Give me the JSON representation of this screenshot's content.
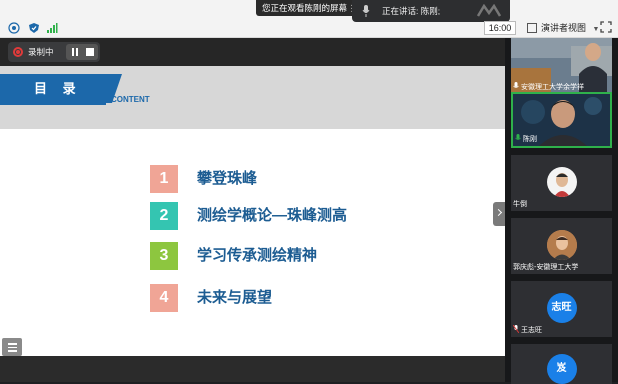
{
  "toolbar": {
    "share_notice": "您正在观看陈刚的屏幕",
    "more_dots": "⋮",
    "speaking_label": "正在讲话: 陈刚;",
    "clock": "16:00",
    "view_mode": "演讲者视图",
    "view_caret": "▼"
  },
  "recording": {
    "label": "录制中"
  },
  "slide": {
    "title": "目 录",
    "subtitle": "CONTENT",
    "items": [
      {
        "num": "1",
        "text": "攀登珠峰",
        "color": "#f0a596"
      },
      {
        "num": "2",
        "text": "测绘学概论—珠峰测高",
        "color": "#34c5b1"
      },
      {
        "num": "3",
        "text": "学习传承测绘精神",
        "color": "#8dc63f"
      },
      {
        "num": "4",
        "text": "未来与展望",
        "color": "#f0a596"
      }
    ]
  },
  "participants": [
    {
      "name": "安徽理工大学余学祥",
      "type": "video"
    },
    {
      "name": "陈刚",
      "type": "video"
    },
    {
      "name": "牛倒",
      "type": "avatar"
    },
    {
      "name": "郭庆彪-安徽理工大学",
      "type": "avatar"
    },
    {
      "name": "王志旺",
      "type": "text-avatar",
      "avatar_text": "志旺"
    },
    {
      "name": "",
      "type": "text-avatar",
      "avatar_text": "岌"
    }
  ],
  "colors": {
    "accent_blue": "#1c68aa",
    "active_border": "#2fb14b",
    "recording_red": "#e03a3a"
  }
}
